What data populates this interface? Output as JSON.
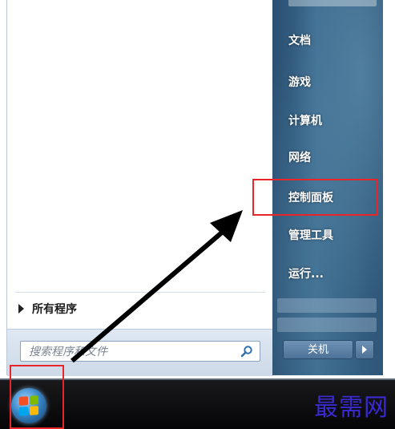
{
  "left_pane": {
    "all_programs_label": "所有程序",
    "search_placeholder": "搜索程序和文件"
  },
  "right_pane": {
    "items": [
      {
        "label": "文档"
      },
      {
        "label": "游戏"
      },
      {
        "label": "计算机"
      },
      {
        "label": "网络"
      },
      {
        "label": "控制面板"
      },
      {
        "label": "管理工具"
      },
      {
        "label": "运行..."
      }
    ],
    "shutdown_label": "关机"
  },
  "taskbar": {
    "watermark": "最需网"
  },
  "colors": {
    "annotation_red": "#e8262a",
    "arrow": "#000000"
  },
  "icons": [
    "search-icon",
    "windows-start-orb-icon",
    "right-triangle-icon"
  ]
}
